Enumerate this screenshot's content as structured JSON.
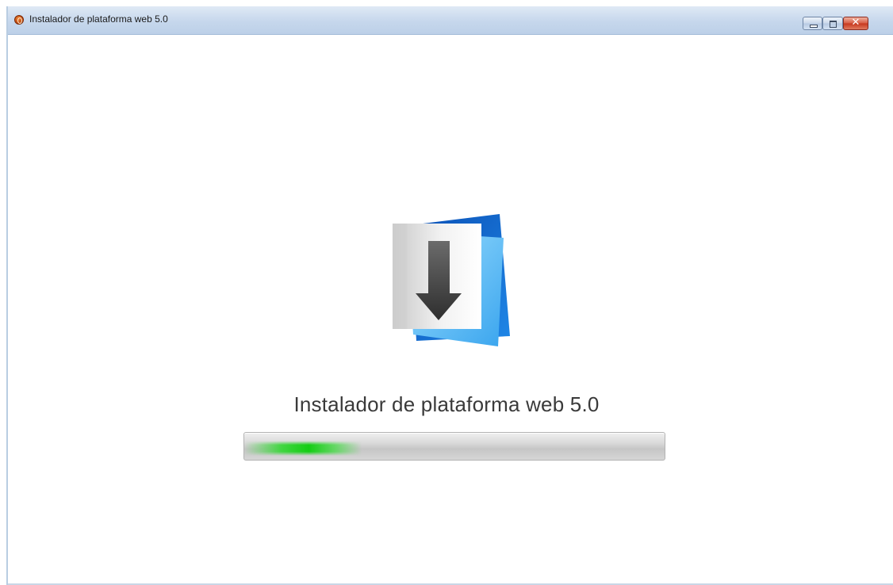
{
  "window": {
    "title": "Instalador de plataforma web 5.0",
    "controls": {
      "minimize": "minimize-icon",
      "maximize": "maximize-icon",
      "close": "close-icon"
    }
  },
  "main": {
    "logo_icon": "download-arrow-icon",
    "product_title": "Instalador de plataforma web 5.0",
    "progress": {
      "fraction": 0.28,
      "color": "#1fcc1f"
    }
  },
  "colors": {
    "accent_blue": "#1e88e5",
    "progress_green": "#1fcc1f"
  }
}
